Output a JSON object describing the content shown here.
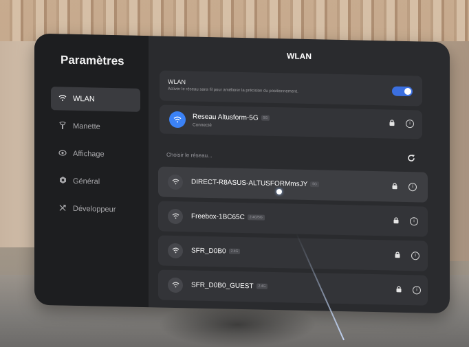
{
  "sidebar": {
    "title": "Paramètres",
    "items": [
      {
        "label": "WLAN",
        "icon": "wifi-icon",
        "active": true
      },
      {
        "label": "Manette",
        "icon": "controller-icon",
        "active": false
      },
      {
        "label": "Affichage",
        "icon": "eye-icon",
        "active": false
      },
      {
        "label": "Général",
        "icon": "gear-icon",
        "active": false
      },
      {
        "label": "Développeur",
        "icon": "tools-icon",
        "active": false
      }
    ]
  },
  "main": {
    "title": "WLAN",
    "wlan_toggle": {
      "label": "WLAN",
      "description": "Activer le réseau sans fil pour améliorer la précision du positionnement.",
      "enabled": true
    },
    "connected": {
      "name": "Reseau Altusform-5G",
      "band": "5G",
      "status": "Connecté"
    },
    "choose_label": "Choisir le réseau...",
    "networks": [
      {
        "name": "DIRECT-R8ASUS-ALTUSFORMmsJY",
        "band": "5G"
      },
      {
        "name": "Freebox-1BC65C",
        "band": "2.4G/5G"
      },
      {
        "name": "SFR_D0B0",
        "band": "2.4G"
      },
      {
        "name": "SFR_D0B0_GUEST",
        "band": "2.4G"
      }
    ]
  },
  "colors": {
    "accent": "#3b82f6",
    "panel": "#2a2b2e",
    "sidebar": "#1d1e20"
  }
}
